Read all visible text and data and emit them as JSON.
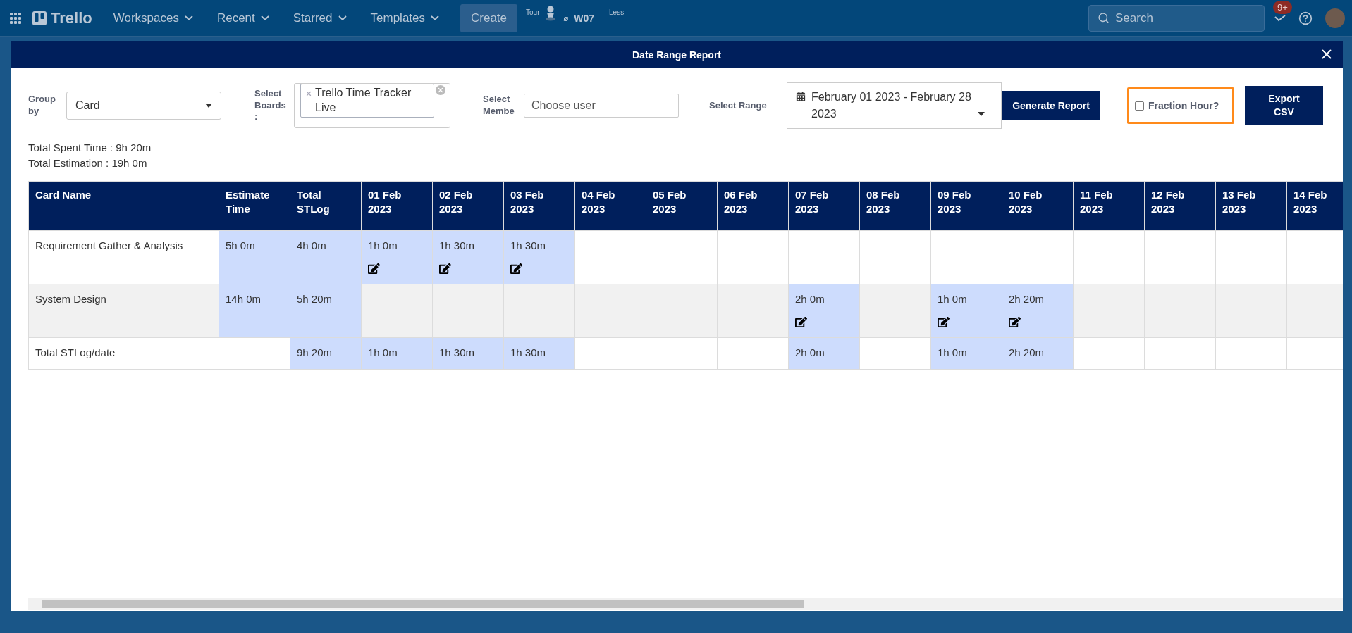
{
  "topbar": {
    "logo": "Trello",
    "menus": [
      {
        "label": "Workspaces"
      },
      {
        "label": "Recent"
      },
      {
        "label": "Starred"
      },
      {
        "label": "Templates"
      }
    ],
    "create": "Create",
    "tour": "Tour",
    "mark": "ø",
    "code": "W07",
    "less": "Less",
    "search": {
      "placeholder": "Search"
    },
    "notification_count": "9+"
  },
  "modal": {
    "title": "Date Range Report",
    "filters": {
      "group_by": {
        "label": "Group by",
        "value": "Card"
      },
      "boards": {
        "label": "Select Boards :",
        "tags": [
          "Trello Time Tracker Live"
        ]
      },
      "member": {
        "label": "Select Membe",
        "placeholder": "Choose user"
      },
      "range": {
        "label": "Select Range",
        "value": "February 01 2023 - February 28 2023"
      },
      "generate": "Generate Report",
      "fraction_hour": {
        "label": "Fraction Hour?",
        "checked": false
      },
      "export": "Export CSV"
    },
    "totals": [
      "Total Spent Time : 9h 20m",
      "Total Estimation : 19h 0m"
    ],
    "table": {
      "columns": [
        "Card Name",
        "Estimate Time",
        "Total STLog",
        "01 Feb 2023",
        "02 Feb 2023",
        "03 Feb 2023",
        "04 Feb 2023",
        "05 Feb 2023",
        "06 Feb 2023",
        "07 Feb 2023",
        "08 Feb 2023",
        "09 Feb 2023",
        "10 Feb 2023",
        "11 Feb 2023",
        "12 Feb 2023",
        "13 Feb 2023",
        "14 Feb 2023"
      ],
      "rows": [
        {
          "cells": [
            {
              "text": "Requirement Gather & Analysis",
              "highlighted": false,
              "editable": false
            },
            {
              "text": "5h 0m",
              "highlighted": true,
              "editable": false
            },
            {
              "text": "4h 0m",
              "highlighted": true,
              "editable": false
            },
            {
              "text": "1h 0m",
              "highlighted": true,
              "editable": true
            },
            {
              "text": "1h 30m",
              "highlighted": true,
              "editable": true
            },
            {
              "text": "1h 30m",
              "highlighted": true,
              "editable": true
            },
            {
              "highlighted": false,
              "editable": false
            },
            {
              "highlighted": false,
              "editable": false
            },
            {
              "highlighted": false,
              "editable": false
            },
            {
              "highlighted": false,
              "editable": false
            },
            {
              "highlighted": false,
              "editable": false
            },
            {
              "highlighted": false,
              "editable": false
            },
            {
              "highlighted": false,
              "editable": false
            },
            {
              "highlighted": false,
              "editable": false
            },
            {
              "highlighted": false,
              "editable": false
            },
            {
              "highlighted": false,
              "editable": false
            },
            {
              "highlighted": false,
              "editable": false
            }
          ]
        },
        {
          "cells": [
            {
              "text": "System Design",
              "highlighted": false,
              "editable": false
            },
            {
              "text": "14h 0m",
              "highlighted": true,
              "editable": false
            },
            {
              "text": "5h 20m",
              "highlighted": true,
              "editable": false
            },
            {
              "highlighted": false,
              "editable": false
            },
            {
              "highlighted": false,
              "editable": false
            },
            {
              "highlighted": false,
              "editable": false
            },
            {
              "highlighted": false,
              "editable": false
            },
            {
              "highlighted": false,
              "editable": false
            },
            {
              "highlighted": false,
              "editable": false
            },
            {
              "text": "2h 0m",
              "highlighted": true,
              "editable": true
            },
            {
              "highlighted": false,
              "editable": false
            },
            {
              "text": "1h 0m",
              "highlighted": true,
              "editable": true
            },
            {
              "text": "2h 20m",
              "highlighted": true,
              "editable": true
            },
            {
              "highlighted": false,
              "editable": false
            },
            {
              "highlighted": false,
              "editable": false
            },
            {
              "highlighted": false,
              "editable": false
            },
            {
              "highlighted": false,
              "editable": false
            }
          ]
        },
        {
          "cells": [
            {
              "text": "Total STLog/date",
              "highlighted": false,
              "editable": false
            },
            {
              "highlighted": false,
              "editable": false
            },
            {
              "text": "9h 20m",
              "highlighted": true,
              "editable": false
            },
            {
              "text": "1h 0m",
              "highlighted": true,
              "editable": false
            },
            {
              "text": "1h 30m",
              "highlighted": true,
              "editable": false
            },
            {
              "text": "1h 30m",
              "highlighted": true,
              "editable": false
            },
            {
              "highlighted": false,
              "editable": false
            },
            {
              "highlighted": false,
              "editable": false
            },
            {
              "highlighted": false,
              "editable": false
            },
            {
              "text": "2h 0m",
              "highlighted": true,
              "editable": false
            },
            {
              "highlighted": false,
              "editable": false
            },
            {
              "text": "1h 0m",
              "highlighted": true,
              "editable": false
            },
            {
              "text": "2h 20m",
              "highlighted": true,
              "editable": false
            },
            {
              "highlighted": false,
              "editable": false
            },
            {
              "highlighted": false,
              "editable": false
            },
            {
              "highlighted": false,
              "editable": false
            },
            {
              "highlighted": false,
              "editable": false
            }
          ]
        }
      ]
    }
  }
}
